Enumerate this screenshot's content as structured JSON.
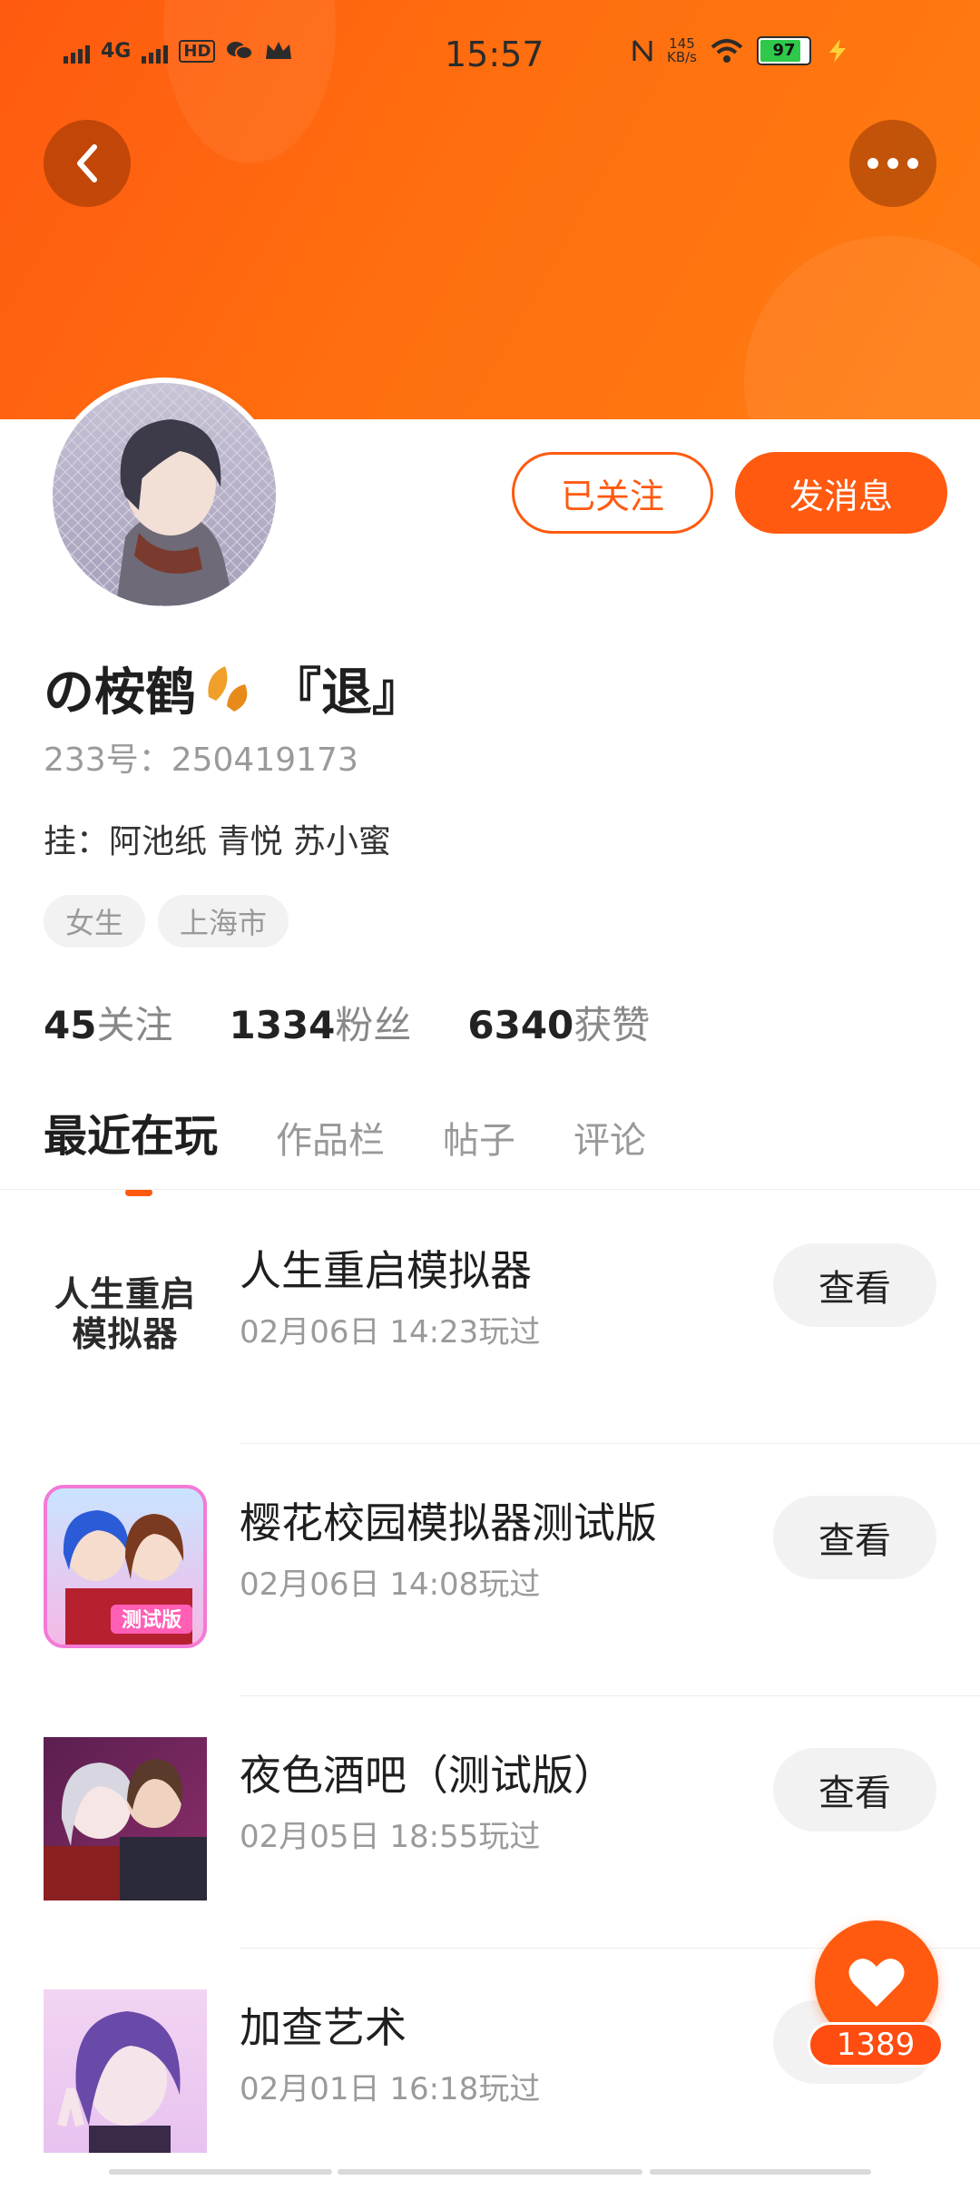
{
  "status_bar": {
    "network": "4G",
    "hd": "HD",
    "time": "15:57",
    "speed_value": "145",
    "speed_unit": "KB/s",
    "battery": "97"
  },
  "profile": {
    "name": "の桉鹤",
    "name_suffix": "『退』",
    "uid": "233号：250419173",
    "pending": "挂：阿池纸 青悦 苏小蜜",
    "tags": [
      "女生",
      "上海市"
    ],
    "stats": [
      {
        "count": "45",
        "label": "关注"
      },
      {
        "count": "1334",
        "label": "粉丝"
      },
      {
        "count": "6340",
        "label": "获赞"
      }
    ]
  },
  "actions": {
    "follow_label": "已关注",
    "message_label": "发消息"
  },
  "tabs": [
    "最近在玩",
    "作品栏",
    "帖子",
    "评论"
  ],
  "games": [
    {
      "title": "人生重启模拟器",
      "time": "02月06日 14:23玩过",
      "button": "查看",
      "icon_text_1": "人生重启",
      "icon_text_2": "模拟器"
    },
    {
      "title": "樱花校园模拟器测试版",
      "time": "02月06日 14:08玩过",
      "button": "查看",
      "icon_badge": "测试版"
    },
    {
      "title": "夜色酒吧（测试版）",
      "time": "02月05日 18:55玩过",
      "button": "查看"
    },
    {
      "title": "加查艺术",
      "time": "02月01日 16:18玩过",
      "button": "查看"
    }
  ],
  "like_float": {
    "count": "1389"
  },
  "colors": {
    "accent": "#ff5a10",
    "muted": "#9a9a9a"
  }
}
